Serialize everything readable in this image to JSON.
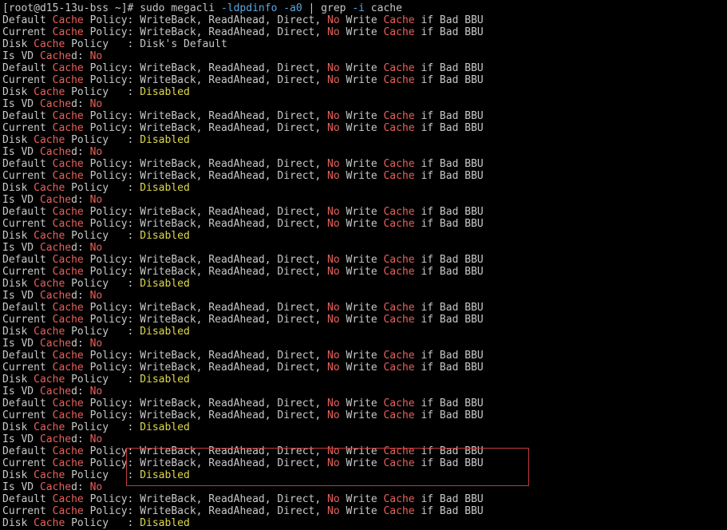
{
  "terminal": {
    "prompt": "[root@d15-13u-bss ~]#",
    "command_parts": [
      {
        "text": " sudo megacli ",
        "style": ""
      },
      {
        "text": "-ldpdinfo -a0",
        "style": "cyan"
      },
      {
        "text": " | grep ",
        "style": ""
      },
      {
        "text": "-i",
        "style": "cyan"
      },
      {
        "text": " cache",
        "style": ""
      }
    ],
    "labels": {
      "default": "Default ",
      "current": "Current ",
      "disk": "Disk ",
      "is_vd": "Is VD ",
      "cache": "Cache",
      "cached_pre": "Cache",
      "cached_post": "d: ",
      "policy_sep": " Policy: ",
      "disk_policy_sep": " Policy   : ",
      "policy_value_1": "WriteBack, ReadAhead, Direct, ",
      "no": "No",
      "write": " Write ",
      "if_bad": " if Bad BBU"
    },
    "disk_policy_first": "Disk's Default",
    "disk_policy_disabled": "Disabled"
  },
  "colors": {
    "background": "#000000",
    "foreground": "#c8c8c8",
    "match": "#e8605a",
    "option": "#5aa8e0",
    "value": "#e0d84a",
    "annotation_box": "#c23a3a"
  }
}
